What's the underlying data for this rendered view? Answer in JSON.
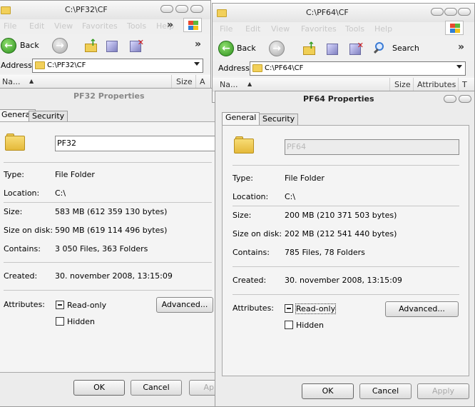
{
  "left": {
    "explorer": {
      "title": "C:\\PF32\\CF",
      "menu": [
        "File",
        "Edit",
        "View",
        "Favorites",
        "Tools",
        "Help"
      ],
      "back_label": "Back",
      "address_label": "Address",
      "address_value": "C:\\PF32\\CF",
      "columns": [
        "Na...",
        "Size",
        "A"
      ]
    },
    "dialog": {
      "title": "PF32 Properties",
      "tabs": [
        "General",
        "Security"
      ],
      "name_value": "PF32",
      "type_label": "Type:",
      "type_value": "File Folder",
      "location_label": "Location:",
      "location_value": "C:\\",
      "size_label": "Size:",
      "size_value": "583 MB (612 359 130 bytes)",
      "size_disk_label": "Size on disk:",
      "size_disk_value": "590 MB (619 114 496 bytes)",
      "contains_label": "Contains:",
      "contains_value": "3 050 Files, 363 Folders",
      "created_label": "Created:",
      "created_value": "30. november 2008, 13:15:09",
      "attributes_label": "Attributes:",
      "readonly_label": "Read-only",
      "hidden_label": "Hidden",
      "advanced_label": "Advanced...",
      "ok_label": "OK",
      "cancel_label": "Cancel",
      "apply_label": "Apply"
    }
  },
  "right": {
    "explorer": {
      "title": "C:\\PF64\\CF",
      "menu": [
        "File",
        "Edit",
        "View",
        "Favorites",
        "Tools",
        "Help"
      ],
      "back_label": "Back",
      "search_label": "Search",
      "address_label": "Address",
      "address_value": "C:\\PF64\\CF",
      "columns": [
        "Na...",
        "Size",
        "Attributes",
        "T"
      ]
    },
    "dialog": {
      "title": "PF64 Properties",
      "tabs": [
        "General",
        "Security"
      ],
      "name_value": "PF64",
      "type_label": "Type:",
      "type_value": "File Folder",
      "location_label": "Location:",
      "location_value": "C:\\",
      "size_label": "Size:",
      "size_value": "200 MB (210 371 503 bytes)",
      "size_disk_label": "Size on disk:",
      "size_disk_value": "202 MB (212 541 440 bytes)",
      "contains_label": "Contains:",
      "contains_value": "785 Files, 78 Folders",
      "created_label": "Created:",
      "created_value": "30. november 2008, 13:15:09",
      "attributes_label": "Attributes:",
      "readonly_label": "Read-only",
      "hidden_label": "Hidden",
      "advanced_label": "Advanced...",
      "ok_label": "OK",
      "cancel_label": "Cancel",
      "apply_label": "Apply"
    }
  }
}
